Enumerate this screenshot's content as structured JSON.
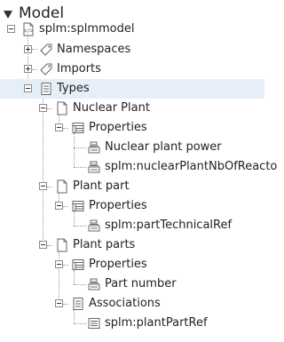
{
  "header": {
    "title": "Model"
  },
  "tree": {
    "root": "splm:splmmodel",
    "namespaces": "Namespaces",
    "imports": "Imports",
    "types": "Types",
    "nuclear_plant": "Nuclear Plant",
    "np_properties": "Properties",
    "np_prop_power": "Nuclear plant power",
    "np_prop_nbof": "splm:nuclearPlantNbOfReacto",
    "plant_part": "Plant part",
    "pp_properties": "Properties",
    "pp_prop_techref": "splm:partTechnicalRef",
    "plant_parts": "Plant parts",
    "pps_properties": "Properties",
    "pps_prop_partnumber": "Part number",
    "pps_associations": "Associations",
    "pps_assoc_plantpartref": "splm:plantPartRef"
  },
  "colors": {
    "selected_row": "#e6eef8"
  }
}
